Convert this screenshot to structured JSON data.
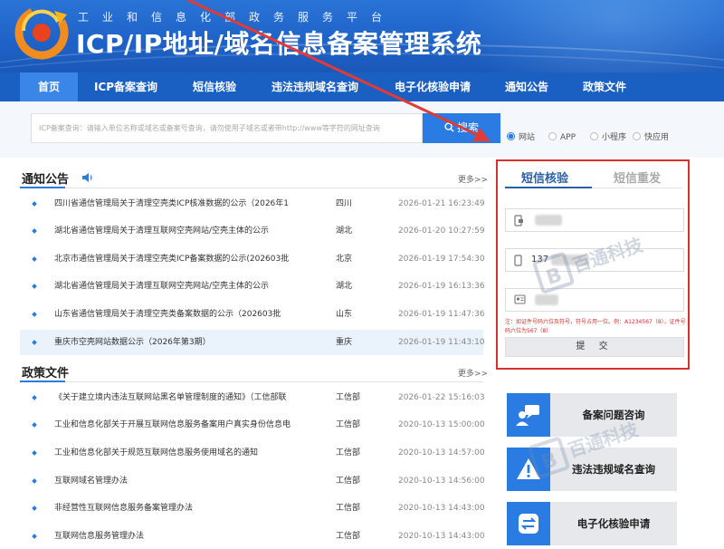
{
  "header": {
    "subtitle": "工业和信息化部政务服务平台",
    "title": "ICP/IP地址/域名信息备案管理系统"
  },
  "nav": {
    "items": [
      {
        "label": "首页",
        "active": true
      },
      {
        "label": "ICP备案查询"
      },
      {
        "label": "短信核验"
      },
      {
        "label": "违法违规域名查询"
      },
      {
        "label": "电子化核验申请"
      },
      {
        "label": "通知公告"
      },
      {
        "label": "政策文件"
      }
    ]
  },
  "search": {
    "placeholder": "ICP备案查询：请输入单位名称或域名或备案号查询，请勿使用子域名或者带http://www等字符的网址查询",
    "button": "搜索",
    "options": [
      {
        "label": "网站",
        "selected": true
      },
      {
        "label": "APP"
      },
      {
        "label": "小程序"
      },
      {
        "label": "快应用"
      }
    ]
  },
  "notices": {
    "title": "通知公告",
    "more": "更多>>",
    "items": [
      {
        "title": "四川省通信管理局关于清理空壳类ICP核准数据的公示（2026年1",
        "region": "四川",
        "date": "2026-01-21 16:23:49"
      },
      {
        "title": "湖北省通信管理局关于清理互联网空壳网站/空壳主体的公示",
        "region": "湖北",
        "date": "2026-01-20 10:27:59"
      },
      {
        "title": "北京市通信管理局关于清理空壳类ICP备案数据的公示(202603批",
        "region": "北京",
        "date": "2026-01-19 17:54:30"
      },
      {
        "title": "湖北省通信管理局关于清理互联网空壳网站/空壳主体的公示",
        "region": "湖北",
        "date": "2026-01-19 16:13:36"
      },
      {
        "title": "山东省通信管理局关于清理空壳类备案数据的公示（202603批",
        "region": "山东",
        "date": "2026-01-19 11:47:36"
      },
      {
        "title": "重庆市空壳网站数据公示（2026年第3期）",
        "region": "重庆",
        "date": "2026-01-19 11:43:10",
        "highlighted": true
      }
    ]
  },
  "policies": {
    "title": "政策文件",
    "more": "更多>>",
    "items": [
      {
        "title": "《关于建立境内违法互联网站黑名单管理制度的通知》（工信部联",
        "region": "工信部",
        "date": "2026-01-22 15:16:03"
      },
      {
        "title": "工业和信息化部关于开展互联网信息服务备案用户真实身份信息电",
        "region": "工信部",
        "date": "2020-10-13 15:00:00"
      },
      {
        "title": "工业和信息化部关于规范互联网信息服务使用域名的通知",
        "region": "工信部",
        "date": "2020-10-13 14:57:00"
      },
      {
        "title": "互联网域名管理办法",
        "region": "工信部",
        "date": "2020-10-13 14:56:00"
      },
      {
        "title": "非经营性互联网信息服务备案管理办法",
        "region": "工信部",
        "date": "2020-10-13 14:43:00"
      },
      {
        "title": "互联网信息服务管理办法",
        "region": "工信部",
        "date": "2020-10-13 14:43:00"
      }
    ]
  },
  "sms": {
    "tab_active": "短信核验",
    "tab_inactive": "短信重发",
    "phone_prefix": "137",
    "note": "注：如证件号码六位及符号，符号占用一位。例：A1234567（8），证件号码六位为567（8）",
    "submit": "提 交"
  },
  "services": [
    {
      "label": "备案问题咨询",
      "icon": "consult-icon"
    },
    {
      "label": "违法违规域名查询",
      "icon": "warning-icon"
    },
    {
      "label": "电子化核验申请",
      "icon": "transfer-icon"
    }
  ],
  "watermark": "百通科技",
  "colors": {
    "brand": "#1f63c8",
    "accent": "#2a7be2",
    "highlight_border": "#d9312e"
  }
}
